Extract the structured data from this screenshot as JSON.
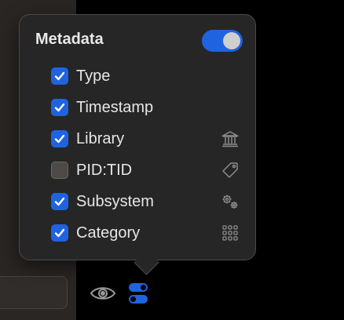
{
  "popover": {
    "title": "Metadata",
    "master_toggle": {
      "on": true
    }
  },
  "items": [
    {
      "label": "Type",
      "checked": true,
      "icon": ""
    },
    {
      "label": "Timestamp",
      "checked": true,
      "icon": ""
    },
    {
      "label": "Library",
      "checked": true,
      "icon": "building-columns-icon"
    },
    {
      "label": "PID:TID",
      "checked": false,
      "icon": "tag-icon"
    },
    {
      "label": "Subsystem",
      "checked": true,
      "icon": "gears-icon"
    },
    {
      "label": "Category",
      "checked": true,
      "icon": "grid-icon"
    }
  ],
  "toolbar": {
    "icons": [
      "eye-icon",
      "toggles-icon"
    ]
  },
  "colors": {
    "accent": "#1f63e0",
    "popover_bg": "#262626",
    "window_bg": "#000000"
  }
}
